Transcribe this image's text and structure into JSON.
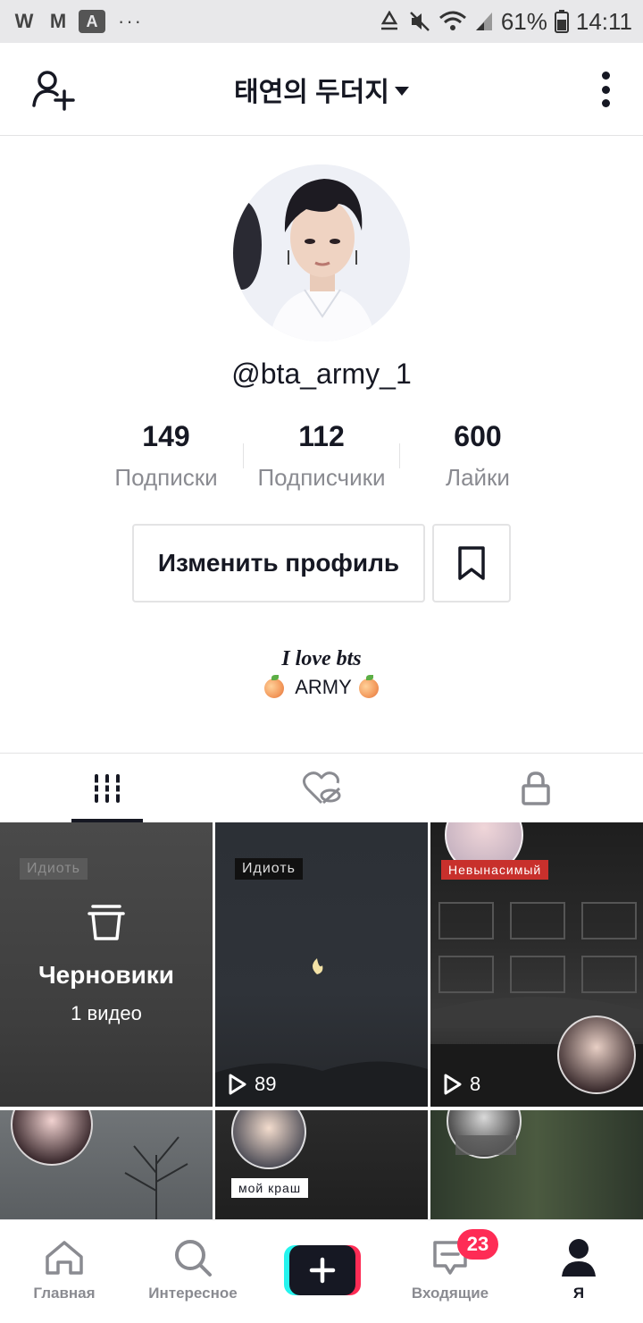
{
  "status_bar": {
    "app_icons": [
      "W",
      "M",
      "A"
    ],
    "more": "···",
    "battery": "61%",
    "time": "14:11"
  },
  "header": {
    "title": "태연의 두더지"
  },
  "profile": {
    "username": "@bta_army_1",
    "stats": [
      {
        "value": "149",
        "label": "Подписки"
      },
      {
        "value": "112",
        "label": "Подписчики"
      },
      {
        "value": "600",
        "label": "Лайки"
      }
    ],
    "edit_button": "Изменить профиль",
    "bio_line1": "I love bts",
    "bio_line2": "ARMY"
  },
  "grid": {
    "drafts": {
      "tag": "Идиоть",
      "title": "Черновики",
      "count": "1 видео"
    },
    "videos": [
      {
        "tag": "Идиоть",
        "views": "89"
      },
      {
        "tag": "Невынасимый",
        "views": "8"
      }
    ],
    "row2_tag": "мой краш"
  },
  "bottom_nav": {
    "home": "Главная",
    "discover": "Интересное",
    "inbox": "Входящие",
    "inbox_badge": "23",
    "me": "Я"
  }
}
